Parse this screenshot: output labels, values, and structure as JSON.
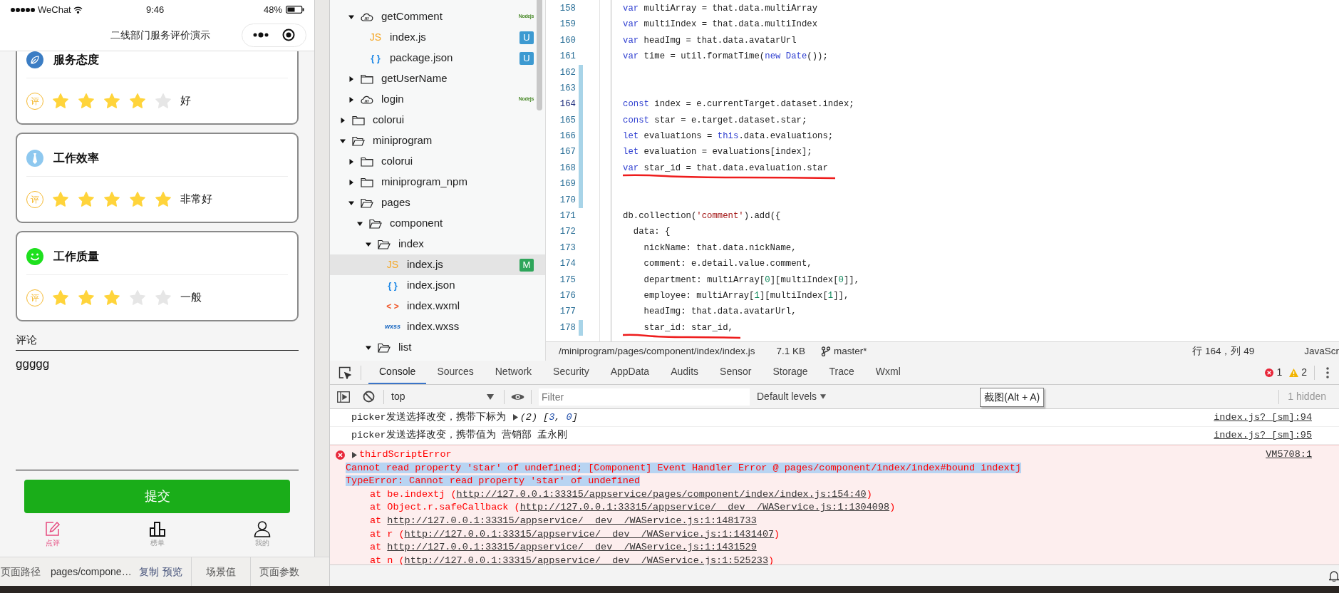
{
  "phone": {
    "status_bar": {
      "carrier": "WeChat",
      "time": "9:46",
      "battery": "48%"
    },
    "nav_title": "二线部门服务评价演示",
    "categories": [
      {
        "title": "服务态度",
        "badge": "评",
        "stars": 4,
        "rating": "好"
      },
      {
        "title": "工作效率",
        "badge": "评",
        "stars": 5,
        "rating": "非常好"
      },
      {
        "title": "工作质量",
        "badge": "评",
        "stars": 3,
        "rating": "一般"
      }
    ],
    "comment": {
      "label": "评论",
      "value": "ggggg"
    },
    "submit": "提交",
    "tabbar": [
      {
        "label": "点评",
        "selected": true
      },
      {
        "label": "榜单",
        "selected": false
      },
      {
        "label": "我的",
        "selected": false
      }
    ]
  },
  "path_bar": {
    "label": "页面路径",
    "path": "pages/compone…",
    "actions": [
      "复制",
      "预览"
    ],
    "scene": "场景值",
    "params": "页面参数"
  },
  "file_tree": [
    {
      "children": [
        {
          "label": "getComment",
          "kind": "cloud",
          "expanded": true,
          "selected": false,
          "runtime": "Nodejs",
          "children": [
            {
              "label": "index.js",
              "kind": "js",
              "glyph": "JS",
              "selected": false,
              "badge": {
                "text": "U",
                "color": "#3d9ad1"
              }
            },
            {
              "label": "package.json",
              "kind": "json",
              "glyph": "{ }",
              "selected": false,
              "badge": {
                "text": "U",
                "color": "#3d9ad1"
              }
            }
          ]
        },
        {
          "label": "getUserName",
          "kind": "folder",
          "expanded": false,
          "selected": false
        },
        {
          "label": "login",
          "kind": "cloud",
          "expanded": false,
          "selected": false,
          "runtime": "Nodejs"
        }
      ]
    },
    {
      "label": "colorui",
      "kind": "folder",
      "expanded": false,
      "selected": false
    },
    {
      "label": "miniprogram",
      "kind": "folder",
      "expanded": true,
      "selected": false,
      "children": [
        {
          "label": "colorui",
          "kind": "folder",
          "expanded": false,
          "selected": false
        },
        {
          "label": "miniprogram_npm",
          "kind": "folder",
          "expanded": false,
          "selected": false
        },
        {
          "label": "pages",
          "kind": "folder",
          "expanded": true,
          "selected": false,
          "children": [
            {
              "label": "component",
              "kind": "folder",
              "expanded": true,
              "selected": false,
              "children": [
                {
                  "label": "index",
                  "kind": "folder",
                  "expanded": true,
                  "selected": false,
                  "children": [
                    {
                      "label": "index.js",
                      "kind": "js",
                      "glyph": "JS",
                      "selected": true,
                      "badge": {
                        "text": "M",
                        "color": "#2ea55a"
                      }
                    },
                    {
                      "label": "index.json",
                      "kind": "json",
                      "glyph": "{ }",
                      "selected": false
                    },
                    {
                      "label": "index.wxml",
                      "kind": "wxml",
                      "glyph": "< >",
                      "selected": false
                    },
                    {
                      "label": "index.wxss",
                      "kind": "wxss",
                      "glyph": "wxss",
                      "selected": false
                    }
                  ]
                },
                {
                  "label": "list",
                  "kind": "folder",
                  "expanded": true,
                  "selected": false
                }
              ]
            }
          ]
        }
      ]
    }
  ],
  "editor": {
    "lines": [
      {
        "number": "158",
        "current": false,
        "modified": false,
        "marked": false,
        "tokens": [
          {
            "kind": "kw",
            "text": "var"
          },
          {
            "kind": "p",
            "text": " multiArray = that.data.multiArray"
          }
        ]
      },
      {
        "number": "159",
        "current": false,
        "modified": false,
        "marked": false,
        "tokens": [
          {
            "kind": "kw",
            "text": "var"
          },
          {
            "kind": "p",
            "text": " multiIndex = that.data.multiIndex"
          }
        ]
      },
      {
        "number": "160",
        "current": false,
        "modified": false,
        "marked": false,
        "tokens": [
          {
            "kind": "kw",
            "text": "var"
          },
          {
            "kind": "p",
            "text": " headImg = that.data.avatarUrl"
          }
        ]
      },
      {
        "number": "161",
        "current": false,
        "modified": false,
        "marked": false,
        "tokens": [
          {
            "kind": "kw",
            "text": "var"
          },
          {
            "kind": "p",
            "text": " time = util.formatTime("
          },
          {
            "kind": "kw",
            "text": "new"
          },
          {
            "kind": "kw",
            "text": " Date"
          },
          {
            "kind": "p",
            "text": "());"
          }
        ]
      },
      {
        "number": "162",
        "current": false,
        "modified": true,
        "marked": false
      },
      {
        "number": "163",
        "current": false,
        "modified": true,
        "marked": false
      },
      {
        "number": "164",
        "current": true,
        "modified": true,
        "marked": false,
        "tokens": [
          {
            "kind": "kw",
            "text": "const"
          },
          {
            "kind": "p",
            "text": " index = e.currentTarget.dataset.index;"
          }
        ]
      },
      {
        "number": "165",
        "current": false,
        "modified": true,
        "marked": false,
        "tokens": [
          {
            "kind": "kw",
            "text": "const"
          },
          {
            "kind": "p",
            "text": " star = e.target.dataset.star;"
          }
        ]
      },
      {
        "number": "166",
        "current": false,
        "modified": true,
        "marked": false,
        "tokens": [
          {
            "kind": "kw",
            "text": "let"
          },
          {
            "kind": "p",
            "text": " evaluations = "
          },
          {
            "kind": "kw",
            "text": "this"
          },
          {
            "kind": "p",
            "text": ".data.evaluations;"
          }
        ]
      },
      {
        "number": "167",
        "current": false,
        "modified": true,
        "marked": false,
        "tokens": [
          {
            "kind": "kw",
            "text": "let"
          },
          {
            "kind": "p",
            "text": " evaluation = evaluations[index];"
          }
        ]
      },
      {
        "number": "168",
        "current": false,
        "modified": true,
        "marked": true,
        "tokens": [
          {
            "kind": "kw",
            "text": "var"
          },
          {
            "kind": "p",
            "text": " star_id = that.data.evaluation.star"
          }
        ]
      },
      {
        "number": "169",
        "current": false,
        "modified": true,
        "marked": false
      },
      {
        "number": "170",
        "current": false,
        "modified": true,
        "marked": false
      },
      {
        "number": "171",
        "current": false,
        "modified": false,
        "marked": false,
        "tokens": [
          {
            "kind": "p",
            "text": "db.collection("
          },
          {
            "kind": "str",
            "text": "'comment'"
          },
          {
            "kind": "p",
            "text": ").add({"
          }
        ]
      },
      {
        "number": "172",
        "current": false,
        "modified": false,
        "marked": false,
        "tokens": [
          {
            "kind": "p",
            "text": "  data: {"
          }
        ]
      },
      {
        "number": "173",
        "current": false,
        "modified": false,
        "marked": false,
        "tokens": [
          {
            "kind": "p",
            "text": "    nickName: that.data.nickName,"
          }
        ]
      },
      {
        "number": "174",
        "current": false,
        "modified": false,
        "marked": false,
        "tokens": [
          {
            "kind": "p",
            "text": "    comment: e.detail.value.comment,"
          }
        ]
      },
      {
        "number": "175",
        "current": false,
        "modified": false,
        "marked": false,
        "tokens": [
          {
            "kind": "p",
            "text": "    department: multiArray["
          },
          {
            "kind": "num",
            "text": "0"
          },
          {
            "kind": "p",
            "text": "][multiIndex["
          },
          {
            "kind": "num",
            "text": "0"
          },
          {
            "kind": "p",
            "text": "]],"
          }
        ]
      },
      {
        "number": "176",
        "current": false,
        "modified": false,
        "marked": false,
        "tokens": [
          {
            "kind": "p",
            "text": "    employee: multiArray["
          },
          {
            "kind": "num",
            "text": "1"
          },
          {
            "kind": "p",
            "text": "][multiIndex["
          },
          {
            "kind": "num",
            "text": "1"
          },
          {
            "kind": "p",
            "text": "]],"
          }
        ]
      },
      {
        "number": "177",
        "current": false,
        "modified": false,
        "marked": false,
        "tokens": [
          {
            "kind": "p",
            "text": "    headImg: that.data.avatarUrl,"
          }
        ]
      },
      {
        "number": "178",
        "current": false,
        "modified": true,
        "marked": true,
        "tokens": [
          {
            "kind": "p",
            "text": "    star_id: star_id,"
          }
        ]
      }
    ],
    "status": {
      "path": "/miniprogram/pages/component/index/index.js",
      "size": "7.1 KB",
      "branch": "master*",
      "cursor": "行 164，列 49",
      "language": "JavaScr"
    }
  },
  "devtools": {
    "tabs": [
      {
        "label": "Console",
        "selected": true
      },
      {
        "label": "Sources",
        "selected": false
      },
      {
        "label": "Network",
        "selected": false
      },
      {
        "label": "Security",
        "selected": false
      },
      {
        "label": "AppData",
        "selected": false
      },
      {
        "label": "Audits",
        "selected": false
      },
      {
        "label": "Sensor",
        "selected": false
      },
      {
        "label": "Storage",
        "selected": false
      },
      {
        "label": "Trace",
        "selected": false
      },
      {
        "label": "Wxml",
        "selected": false
      }
    ],
    "errors": "1",
    "warnings": "2",
    "context": "top",
    "filter_placeholder": "Filter",
    "levels": "Default levels",
    "hidden": "1 hidden",
    "tooltip": "截图(Alt + A)",
    "messages": [
      {
        "kind": "log",
        "source": "index.js? [sm]:94",
        "parts": [
          {
            "kind": "text",
            "text": "picker发送选择改变，携带下标为 "
          },
          {
            "kind": "toggle"
          },
          {
            "kind": "italic",
            "text": "(2) ["
          },
          {
            "kind": "num",
            "text": "3"
          },
          {
            "kind": "italic",
            "text": ", "
          },
          {
            "kind": "num",
            "text": "0"
          },
          {
            "kind": "italic",
            "text": "]"
          }
        ]
      },
      {
        "kind": "log",
        "source": "index.js? [sm]:95",
        "parts": [
          {
            "kind": "text",
            "text": "picker发送选择改变，携带值为 营销部 孟永刚"
          }
        ]
      },
      {
        "kind": "error",
        "source": "VM5708:1",
        "title": "thirdScriptError",
        "lines": [
          {
            "text": "Cannot read property 'star' of undefined; [Component] Event Handler Error @ pages/component/index/index#bound indextj",
            "selected": true
          },
          {
            "text": "TypeError: Cannot read property 'star' of undefined",
            "selected": true
          }
        ],
        "stack": [
          {
            "prefix": "at be.indextj (",
            "url": "http://127.0.0.1:33315/appservice/pages/component/index/index.js:154:40",
            "suffix": ")"
          },
          {
            "prefix": "at Object.r.safeCallback (",
            "url": "http://127.0.0.1:33315/appservice/__dev__/WAService.js:1:1304098",
            "suffix": ")"
          },
          {
            "prefix": "at ",
            "url": "http://127.0.0.1:33315/appservice/__dev__/WAService.js:1:1481733"
          },
          {
            "prefix": "at r (",
            "url": "http://127.0.0.1:33315/appservice/__dev__/WAService.js:1:1431407",
            "suffix": ")"
          },
          {
            "prefix": "at ",
            "url": "http://127.0.0.1:33315/appservice/__dev__/WAService.js:1:1431529"
          },
          {
            "prefix": "at n (",
            "url": "http://127.0.0.1:33315/appservice/__dev__/WAService.js:1:525233",
            "suffix": ")"
          }
        ]
      }
    ]
  }
}
